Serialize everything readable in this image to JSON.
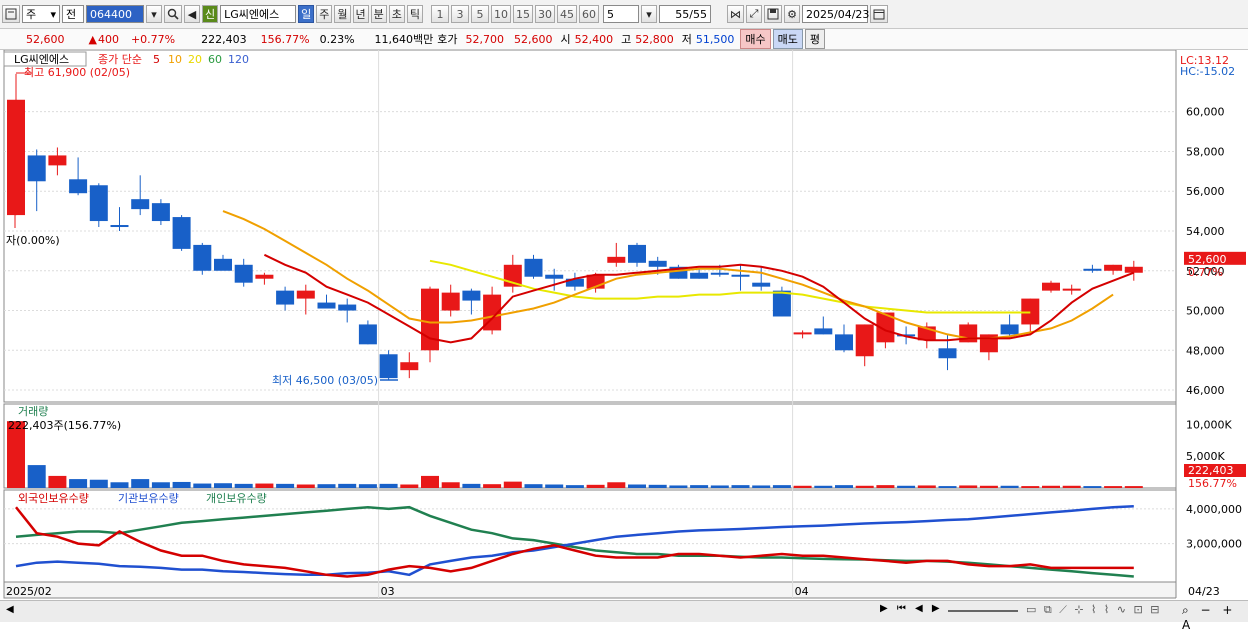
{
  "toolbar": {
    "period_select": "주",
    "view_select": "전",
    "stock_code": "064400",
    "badge": "신",
    "stock_name": "LG씨엔에스",
    "periods": [
      "일",
      "주",
      "월",
      "년",
      "분",
      "초",
      "틱"
    ],
    "selected_period": "일",
    "intervals": [
      "1",
      "3",
      "5",
      "10",
      "15",
      "30",
      "45",
      "60"
    ],
    "count_value": "5",
    "range_value": "55/55",
    "date_value": "2025/04/23"
  },
  "quote": {
    "price": "52,600",
    "change": "400",
    "change_pct": "+0.77%",
    "volume": "222,403",
    "volume_ratio": "156.77%",
    "turnover": "0.23%",
    "amount": "11,640백만",
    "ask_label": "호가",
    "ask1": "52,700",
    "bid1": "52,600",
    "open_label": "시",
    "open": "52,400",
    "high_label": "고",
    "high": "52,800",
    "low_label": "저",
    "low": "51,500",
    "buy_button": "매수",
    "sell_button": "매도",
    "extra_button": "평"
  },
  "chart_data": {
    "type": "candlestick",
    "title": "LG씨엔에스",
    "legend": {
      "label": "종가 단순",
      "periods": [
        "5",
        "10",
        "20",
        "60",
        "120"
      ],
      "colors": [
        "#d40000",
        "#f0a000",
        "#e8d800",
        "#2a9a40",
        "#3a5fd0"
      ]
    },
    "lc_label": "LC:13.12",
    "hc_label": "HC:-15.02",
    "high_label": "최고 61,900 (02/05)",
    "low_label": "최저 46,500 (03/05)",
    "ratio_label": "자(0.00%)",
    "current_label": "52,600",
    "current_pct": "0.77%",
    "y_ticks": [
      60000,
      58000,
      56000,
      54000,
      52000,
      50000,
      48000,
      46000
    ],
    "y_tick_labels": [
      "60,000",
      "58,000",
      "56,000",
      "54,000",
      "52,000",
      "50,000",
      "48,000",
      "46,000"
    ],
    "ylim": [
      45500,
      62700
    ],
    "x_labels": [
      {
        "i": 0,
        "label": "2025/02"
      },
      {
        "i": 18,
        "label": "03"
      },
      {
        "i": 38,
        "label": "04"
      }
    ],
    "x_end_label": "04/23",
    "candles": [
      [
        54800,
        61900,
        54800,
        60600
      ],
      [
        57800,
        58100,
        55000,
        56500
      ],
      [
        57300,
        58200,
        56800,
        57800
      ],
      [
        56600,
        57700,
        55800,
        55900
      ],
      [
        56300,
        56400,
        54200,
        54500
      ],
      [
        54300,
        55200,
        54000,
        54200
      ],
      [
        55600,
        56800,
        54800,
        55100
      ],
      [
        55400,
        55600,
        54300,
        54500
      ],
      [
        54700,
        54800,
        53000,
        53100
      ],
      [
        53300,
        53400,
        51800,
        52000
      ],
      [
        52600,
        52800,
        52200,
        52000
      ],
      [
        52300,
        52600,
        51200,
        51400
      ],
      [
        51600,
        51900,
        51300,
        51800
      ],
      [
        51000,
        51200,
        50000,
        50300
      ],
      [
        50600,
        51300,
        49800,
        51000
      ],
      [
        50400,
        50800,
        50100,
        50100
      ],
      [
        50300,
        50600,
        49400,
        50000
      ],
      [
        49300,
        49500,
        48300,
        48300
      ],
      [
        47800,
        48000,
        46500,
        46600
      ],
      [
        47000,
        47900,
        46600,
        47400
      ],
      [
        48000,
        51200,
        47400,
        51100
      ],
      [
        50000,
        51300,
        49700,
        50900
      ],
      [
        51000,
        51100,
        49800,
        50500
      ],
      [
        49000,
        51200,
        48800,
        50800
      ],
      [
        51200,
        52800,
        50900,
        52300
      ],
      [
        52600,
        52800,
        51600,
        51700
      ],
      [
        51800,
        52100,
        51000,
        51600
      ],
      [
        51600,
        51900,
        51000,
        51200
      ],
      [
        51100,
        51900,
        50900,
        51800
      ],
      [
        52400,
        53400,
        52200,
        52700
      ],
      [
        53300,
        53400,
        52200,
        52400
      ],
      [
        52500,
        52700,
        51800,
        52200
      ],
      [
        52200,
        52300,
        51600,
        51600
      ],
      [
        51900,
        52100,
        51600,
        51600
      ],
      [
        51900,
        52300,
        51700,
        51800
      ],
      [
        51800,
        52300,
        51000,
        51700
      ],
      [
        51400,
        52200,
        51000,
        51200
      ],
      [
        51000,
        51200,
        49700,
        49700
      ],
      [
        48800,
        49000,
        48600,
        48900
      ],
      [
        49100,
        49700,
        48800,
        48800
      ],
      [
        48800,
        49300,
        47900,
        48000
      ],
      [
        47700,
        49300,
        47200,
        49300
      ],
      [
        48400,
        49900,
        48100,
        49900
      ],
      [
        48800,
        49200,
        48300,
        48700
      ],
      [
        48500,
        49400,
        48100,
        49200
      ],
      [
        48100,
        48800,
        47000,
        47600
      ],
      [
        48400,
        49400,
        48400,
        49300
      ],
      [
        47900,
        48800,
        47500,
        48800
      ],
      [
        49300,
        49800,
        48600,
        48800
      ],
      [
        49300,
        50600,
        48900,
        50600
      ],
      [
        51000,
        51500,
        50900,
        51400
      ],
      [
        51000,
        51300,
        50800,
        51100
      ],
      [
        52100,
        52300,
        51900,
        52000
      ],
      [
        52000,
        52300,
        51800,
        52300
      ],
      [
        51900,
        52500,
        51500,
        52200
      ]
    ],
    "ma5": [
      52800,
      52300,
      51900,
      51200,
      50800,
      50400,
      49800,
      49200,
      48600,
      48400,
      48600,
      49600,
      50700,
      51000,
      51300,
      51600,
      51800,
      51800,
      51900,
      52000,
      52100,
      52200,
      52200,
      52300,
      52200,
      52000,
      51700,
      51200,
      50400,
      49600,
      49000,
      48700,
      48500,
      48500,
      48600,
      48600,
      48600,
      48800,
      49500,
      50400,
      51100,
      51500,
      51900
    ],
    "ma10": [
      55000,
      54600,
      54100,
      53500,
      52900,
      52300,
      51600,
      51000,
      50300,
      49600,
      49400,
      49400,
      49500,
      49700,
      49900,
      50100,
      50400,
      50800,
      51200,
      51600,
      51800,
      51900,
      52000,
      52100,
      52100,
      52000,
      51900,
      51600,
      51300,
      50900,
      50500,
      50200,
      49800,
      49400,
      49100,
      48800,
      48600,
      48600,
      48700,
      48900,
      49100,
      49500,
      50100,
      50800
    ],
    "ma20": [
      52500,
      52300,
      52000,
      51700,
      51400,
      51100,
      50900,
      50700,
      50600,
      50600,
      50600,
      50700,
      50700,
      50800,
      50800,
      50900,
      50900,
      50900,
      50800,
      50600,
      50400,
      50200,
      50100,
      50000,
      49900,
      49900,
      49900,
      49900,
      49900,
      49900
    ],
    "volume_title": "거래량",
    "volume_label": "222,403주(156.77%)",
    "volume_ticks": [
      "10,000K",
      "5,000K"
    ],
    "volume_current": "222,403",
    "volume_pct": "156.77%",
    "volume": [
      10500,
      3600,
      1900,
      1400,
      1300,
      900,
      1400,
      900,
      950,
      700,
      750,
      650,
      700,
      650,
      550,
      600,
      650,
      600,
      650,
      550,
      1900,
      900,
      650,
      600,
      1000,
      600,
      550,
      450,
      500,
      900,
      550,
      500,
      400,
      450,
      400,
      450,
      400,
      450,
      350,
      350,
      450,
      350,
      450,
      350,
      400,
      300,
      400,
      350,
      350,
      300,
      350,
      350,
      300,
      300,
      300
    ],
    "holders": {
      "foreign_label": "외국인보유수량",
      "inst_label": "기관보유수량",
      "indiv_label": "개인보유수량",
      "y_ticks": [
        "4,000,000",
        "3,000,000"
      ],
      "foreign": [
        4050000,
        3300000,
        3200000,
        3000000,
        2950000,
        3350000,
        3050000,
        2800000,
        2650000,
        2650000,
        2500000,
        2400000,
        2350000,
        2300000,
        2200000,
        2100000,
        2050000,
        2100000,
        2250000,
        2350000,
        2300000,
        2200000,
        2300000,
        2500000,
        2700000,
        2850000,
        2950000,
        2800000,
        2650000,
        2600000,
        2600000,
        2600000,
        2700000,
        2700000,
        2650000,
        2600000,
        2650000,
        2700000,
        2650000,
        2650000,
        2600000,
        2550000,
        2500000,
        2450000,
        2500000,
        2500000,
        2400000,
        2350000,
        2350000,
        2400000,
        2300000,
        2300000,
        2300000,
        2300000,
        2300000
      ],
      "inst": [
        2350000,
        2450000,
        2480000,
        2450000,
        2420000,
        2350000,
        2330000,
        2300000,
        2250000,
        2250000,
        2200000,
        2180000,
        2150000,
        2120000,
        2100000,
        2100000,
        2150000,
        2160000,
        2200000,
        2100000,
        2400000,
        2500000,
        2600000,
        2650000,
        2750000,
        2800000,
        2900000,
        3000000,
        3100000,
        3200000,
        3250000,
        3300000,
        3350000,
        3380000,
        3400000,
        3420000,
        3450000,
        3480000,
        3500000,
        3520000,
        3550000,
        3580000,
        3600000,
        3620000,
        3650000,
        3680000,
        3700000,
        3750000,
        3800000,
        3850000,
        3900000,
        3950000,
        4000000,
        4050000,
        4080000
      ],
      "indiv": [
        3200000,
        3250000,
        3300000,
        3350000,
        3350000,
        3300000,
        3400000,
        3500000,
        3600000,
        3650000,
        3700000,
        3750000,
        3800000,
        3850000,
        3900000,
        3950000,
        4000000,
        4050000,
        4000000,
        4050000,
        3800000,
        3600000,
        3400000,
        3300000,
        3150000,
        3100000,
        3000000,
        2900000,
        2800000,
        2750000,
        2700000,
        2700000,
        2650000,
        2650000,
        2650000,
        2620000,
        2600000,
        2600000,
        2580000,
        2560000,
        2550000,
        2540000,
        2520000,
        2500000,
        2500000,
        2480000,
        2450000,
        2400000,
        2350000,
        2300000,
        2250000,
        2200000,
        2150000,
        2100000,
        2050000
      ]
    }
  },
  "colors": {
    "up": "#e81818",
    "down": "#1860c8",
    "ma5": "#d40000",
    "ma10": "#f0a000",
    "ma20": "#e8e800",
    "foreign": "#d40000",
    "inst": "#2050d0",
    "indiv": "#208050"
  },
  "icons": [
    "chart-settings-icon",
    "search-icon",
    "speaker-icon",
    "save-icon",
    "gear-icon",
    "calendar-icon",
    "scroll-left-icon",
    "scroll-right-icon",
    "zoom-out-icon",
    "zoom-in-icon"
  ]
}
